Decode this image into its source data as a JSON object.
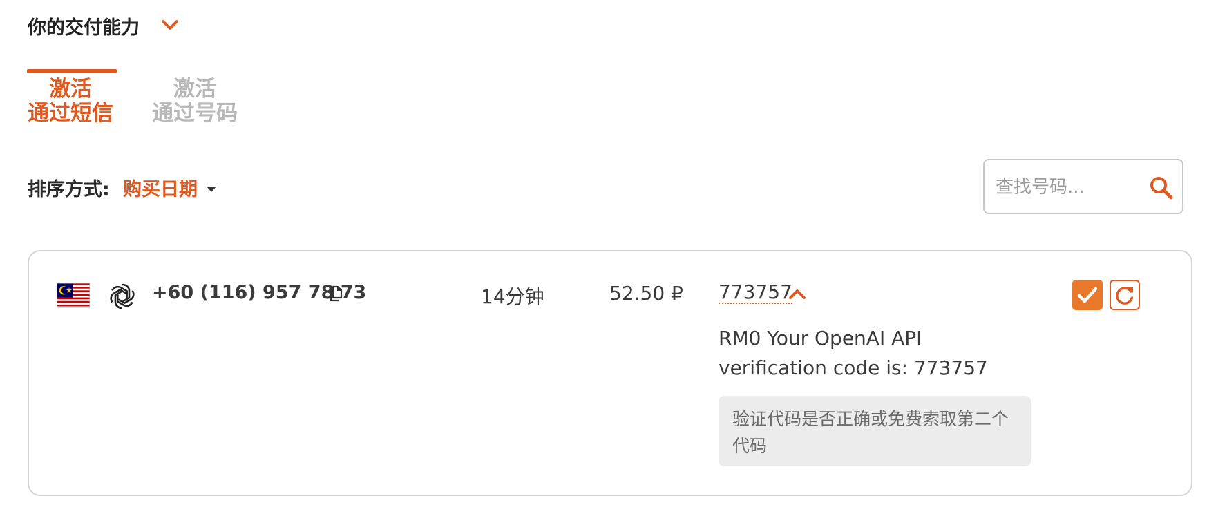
{
  "header": {
    "title": "你的交付能力",
    "chevron_icon": "chevron-down-icon"
  },
  "tabs": [
    {
      "line1": "激活",
      "line2": "通过短信",
      "active": true
    },
    {
      "line1": "激活",
      "line2": "通过号码",
      "active": false
    }
  ],
  "sort": {
    "label": "排序方式:",
    "value": "购买日期"
  },
  "search": {
    "placeholder": "查找号码...",
    "value": "",
    "icon": "search-icon"
  },
  "activation": {
    "country_flag": "malaysia-flag-icon",
    "service_icon": "openai-icon",
    "phone": "+60 (116) 957 78 73",
    "time_left": "14分钟",
    "price": "52.50 ₽",
    "code": "773757",
    "sms_text": "RM0 Your OpenAI API verification code is: 773757",
    "hint": "验证代码是否正确或免费索取第二个代码"
  },
  "colors": {
    "accent": "#dd5a22",
    "confirm_bg": "#e8782a",
    "inactive_tab": "#b8b8b8",
    "hint_bg": "#ececec",
    "border": "#d4d4d4"
  }
}
